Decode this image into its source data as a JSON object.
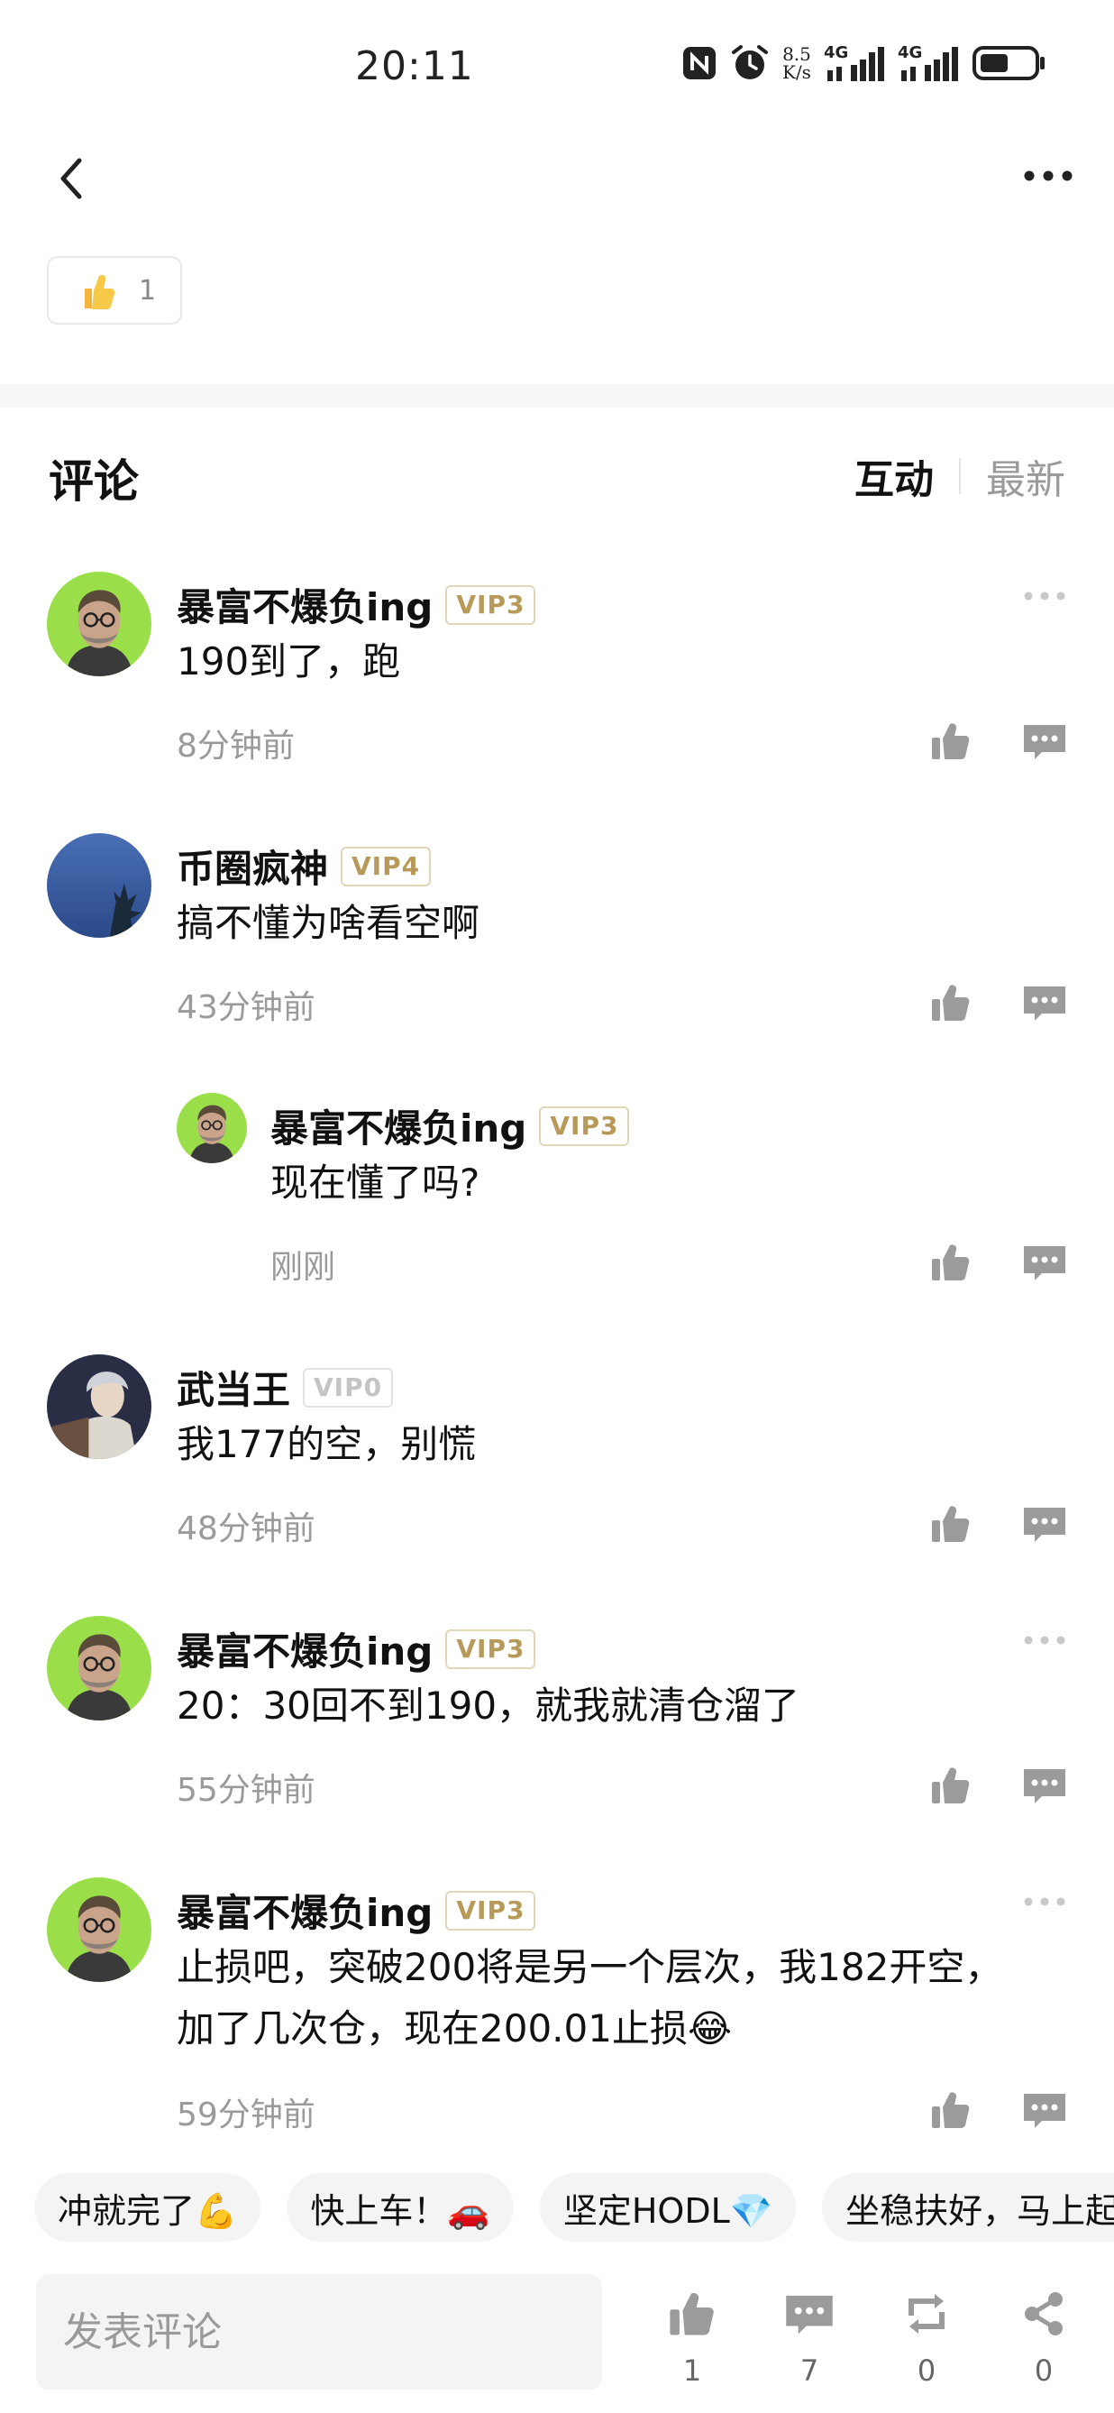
{
  "status_bar": {
    "time": "20:11",
    "net_speed_value": "8.5",
    "net_speed_unit": "K/s",
    "signal_1_label": "4G",
    "signal_2_label": "4G",
    "icons": [
      "nfc-icon",
      "alarm-icon",
      "signal-icon",
      "signal-icon",
      "battery-icon"
    ]
  },
  "header": {
    "back_icon": "chevron-left-icon",
    "more_icon": "more-horizontal-icon",
    "like_count": "1"
  },
  "comments_section": {
    "title": "评论",
    "sort_tabs": [
      {
        "label": "互动",
        "active": true
      },
      {
        "label": "最新",
        "active": false
      }
    ]
  },
  "comments": [
    {
      "user": "暴富不爆负ing",
      "vip": "VIP3",
      "text": "190到了，跑",
      "time": "8分钟前",
      "avatar": "man-glasses"
    },
    {
      "user": "币圈疯神",
      "vip": "VIP4",
      "text": "搞不懂为啥看空啊",
      "time": "43分钟前",
      "avatar": "night-sky"
    },
    {
      "user": "暴富不爆负ing",
      "vip": "VIP3",
      "text": "现在懂了吗?",
      "time": "刚刚",
      "avatar": "man-glasses",
      "reply": true
    },
    {
      "user": "武当王",
      "vip": "VIP0",
      "text": "我177的空，别慌",
      "time": "48分钟前",
      "avatar": "anime"
    },
    {
      "user": "暴富不爆负ing",
      "vip": "VIP3",
      "text": "20：30回不到190，就我就清仓溜了",
      "time": "55分钟前",
      "avatar": "man-glasses"
    },
    {
      "user": "暴富不爆负ing",
      "vip": "VIP3",
      "text": "止损吧，突破200将是另一个层次，我182开空，加了几次仓，现在200.01止损😂",
      "time": "59分钟前",
      "avatar": "man-glasses"
    }
  ],
  "quick_replies": [
    "冲就完了💪",
    "快上车！🚗",
    "坚定HODL💎",
    "坐稳扶好，马上起飞"
  ],
  "bottom_bar": {
    "input_placeholder": "发表评论",
    "like_count": "1",
    "comment_count": "7",
    "repost_count": "0",
    "share_count": "0"
  },
  "colors": {
    "vip_gold": "#b79a5a",
    "muted_text": "#9a9a9a",
    "icon_gray": "#9b9b9b",
    "avatar_green": "#9adf4a"
  }
}
